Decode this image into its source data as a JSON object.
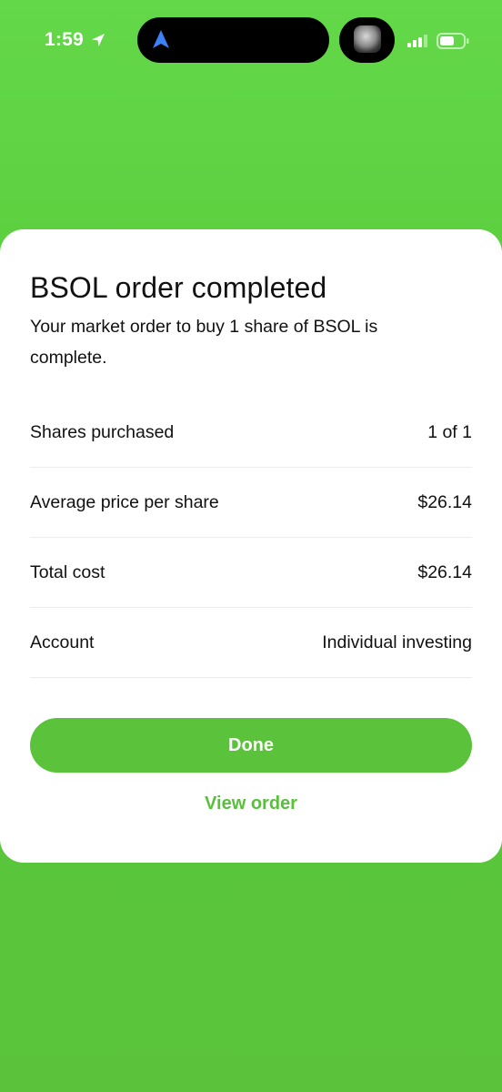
{
  "status_bar": {
    "time": "1:59",
    "icons": [
      "location-arrow-icon",
      "navigation-arrow-icon",
      "avatar",
      "signal-icon",
      "battery-icon"
    ]
  },
  "colors": {
    "background": "#5ccf3f",
    "accent": "#5ac33b",
    "card": "#ffffff",
    "text": "#111111"
  },
  "sheet": {
    "title": "BSOL order completed",
    "subtitle": "Your market order to buy 1 share of BSOL is complete.",
    "rows": [
      {
        "label": "Shares purchased",
        "value": "1 of 1"
      },
      {
        "label": "Average price per share",
        "value": "$26.14"
      },
      {
        "label": "Total cost",
        "value": "$26.14"
      },
      {
        "label": "Account",
        "value": "Individual investing"
      }
    ],
    "done_label": "Done",
    "view_order_label": "View order"
  }
}
